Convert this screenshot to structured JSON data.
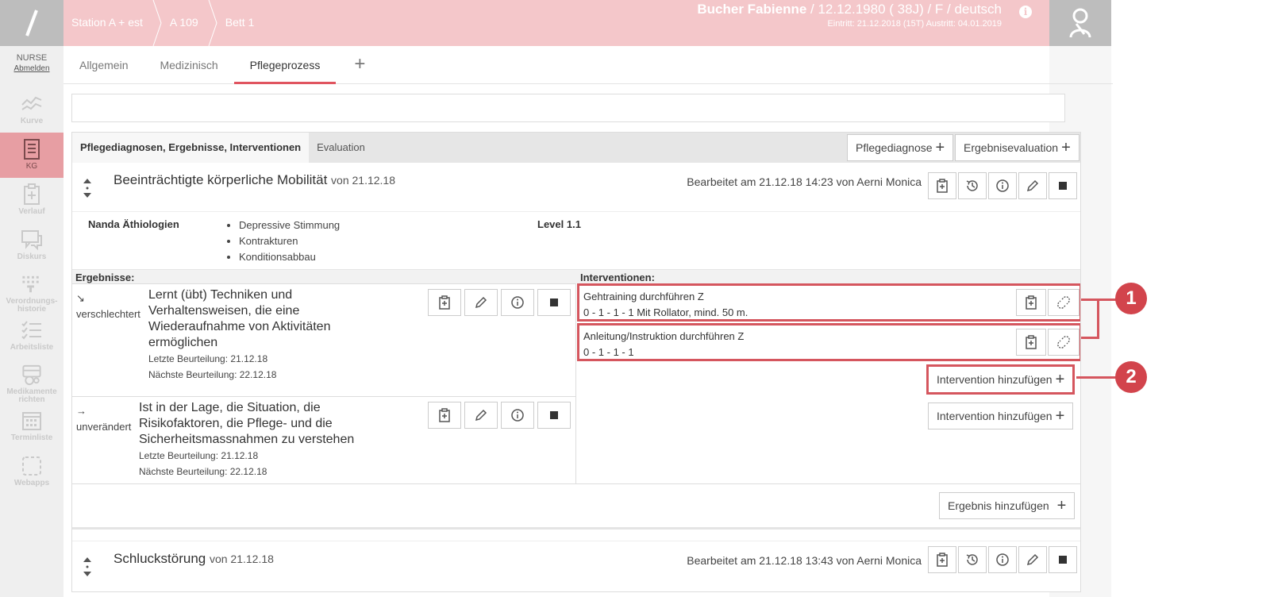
{
  "sidebar": {
    "user_role": "NURSE",
    "logout": "Abmelden",
    "items": [
      {
        "label": "Kurve",
        "icon": "chart-icon"
      },
      {
        "label": "KG",
        "icon": "document-list-icon"
      },
      {
        "label": "Verlauf",
        "icon": "clipboard-plus-icon"
      },
      {
        "label": "Diskurs",
        "icon": "chat-icon"
      },
      {
        "label": "Verordnungs-historie",
        "icon": "prescription-history-icon"
      },
      {
        "label": "Arbeitsliste",
        "icon": "checklist-icon"
      },
      {
        "label": "Medikamente richten",
        "icon": "medication-icon"
      },
      {
        "label": "Terminliste",
        "icon": "calendar-icon"
      },
      {
        "label": "Webapps",
        "icon": "webapps-icon"
      }
    ]
  },
  "header": {
    "crumbs": [
      "Station A + est",
      "A 109",
      "Bett 1"
    ],
    "patient_name": "Bucher Fabienne",
    "patient_details": " / 12.12.1980 ( 38J) / F / deutsch",
    "admission": "Eintritt: 21.12.2018 (15T) Austritt: 04.01.2019",
    "info": "i"
  },
  "tabs": [
    "Allgemein",
    "Medizinisch",
    "Pflegeprozess"
  ],
  "panel": {
    "tabs": [
      "Pflegediagnosen, Ergebnisse, Interventionen",
      "Evaluation"
    ],
    "btn_diagnose": "Pflegediagnose",
    "btn_evaluation": "Ergebnisevaluation"
  },
  "diagnosis1": {
    "title": "Beeinträchtigte körperliche Mobilität",
    "date": "von 21.12.18",
    "meta": "Bearbeitet am 21.12.18 14:23 von Aerni Monica",
    "nanda_label": "Nanda Äthiologien",
    "nanda_items": [
      "Depressive Stimmung",
      "Kontrakturen",
      "Konditionsabbau"
    ],
    "level": "Level 1.1",
    "results_label": "Ergebnisse:",
    "interventions_label": "Interventionen:",
    "results": [
      {
        "trend_arrow": "↘",
        "trend": "verschlechtert",
        "text": "Lernt (übt) Techniken und Verhaltensweisen, die eine Wiederaufnahme von Aktivitäten ermöglichen",
        "last": "Letzte Beurteilung: 21.12.18",
        "next": "Nächste Beurteilung: 22.12.18"
      },
      {
        "trend_arrow": "→",
        "trend": "unverändert",
        "text": "Ist in der Lage, die Situation, die Risikofaktoren, die Pflege- und die Sicherheitsmassnahmen zu verstehen",
        "last": "Letzte Beurteilung: 21.12.18",
        "next": "Nächste Beurteilung: 22.12.18"
      }
    ],
    "interventions": [
      {
        "title": "Gehtraining durchführen Z",
        "detail": "0 - 1 - 1 - 1 Mit Rollator, mind. 50 m."
      },
      {
        "title": "Anleitung/Instruktion durchführen Z",
        "detail": "0 - 1 - 1 - 1"
      }
    ],
    "add_intervention": "Intervention hinzufügen",
    "add_result": "Ergebnis hinzufügen"
  },
  "diagnosis2": {
    "title": "Schluckstörung",
    "date": "von 21.12.18",
    "meta": "Bearbeitet am 21.12.18 13:43 von Aerni Monica"
  },
  "callouts": [
    "1",
    "2"
  ],
  "colors": {
    "header": "#f4c7ca",
    "accent": "#e0545f",
    "callout": "#d2444c",
    "active_nav": "#e79ea3"
  }
}
